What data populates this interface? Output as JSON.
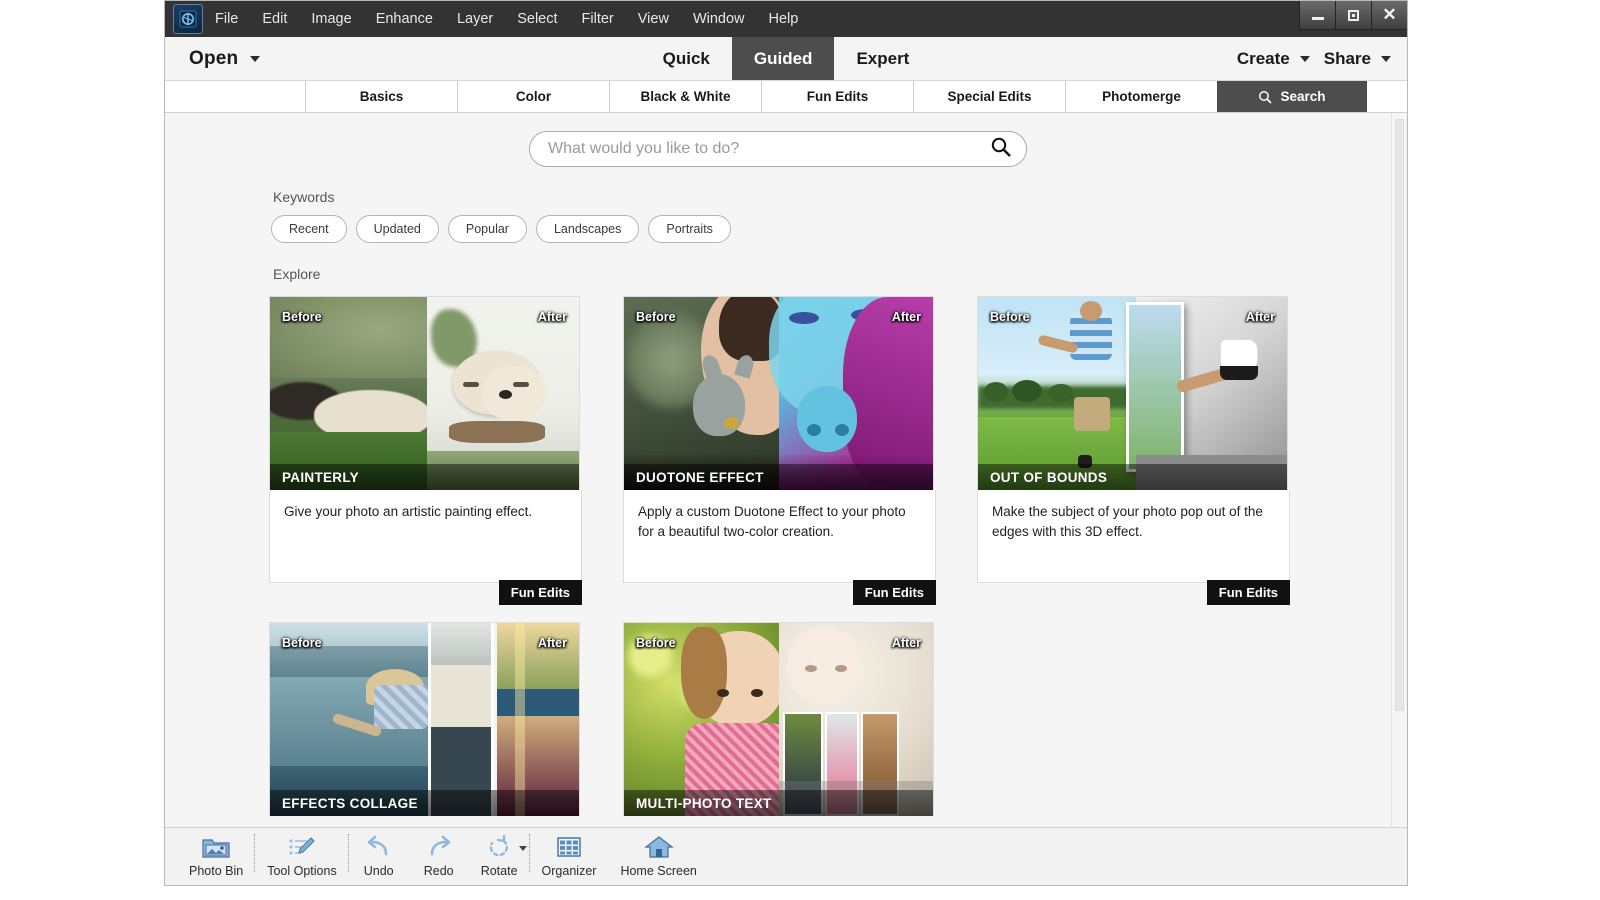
{
  "window": {
    "logo_icon": "photoshop-elements-logo-icon",
    "minimize_label": "minimize-icon",
    "maximize_label": "maximize-icon",
    "close_label": "✕"
  },
  "menubar": {
    "items": [
      {
        "label": "File"
      },
      {
        "label": "Edit"
      },
      {
        "label": "Image"
      },
      {
        "label": "Enhance"
      },
      {
        "label": "Layer"
      },
      {
        "label": "Select"
      },
      {
        "label": "Filter"
      },
      {
        "label": "View"
      },
      {
        "label": "Window"
      },
      {
        "label": "Help"
      }
    ]
  },
  "modebar": {
    "open_label": "Open",
    "modes": [
      {
        "label": "Quick",
        "active": false
      },
      {
        "label": "Guided",
        "active": true
      },
      {
        "label": "Expert",
        "active": false
      }
    ],
    "create_label": "Create",
    "share_label": "Share"
  },
  "tabs": [
    {
      "label": "Basics",
      "active": false
    },
    {
      "label": "Color",
      "active": false
    },
    {
      "label": "Black & White",
      "active": false
    },
    {
      "label": "Fun Edits",
      "active": false
    },
    {
      "label": "Special Edits",
      "active": false
    },
    {
      "label": "Photomerge",
      "active": false
    },
    {
      "label": "Search",
      "active": true,
      "icon": "search-icon"
    }
  ],
  "search": {
    "placeholder": "What would you like to do?",
    "value": "",
    "icon": "search-magnifier-icon"
  },
  "keywords": {
    "title": "Keywords",
    "chips": [
      {
        "label": "Recent"
      },
      {
        "label": "Updated"
      },
      {
        "label": "Popular"
      },
      {
        "label": "Landscapes"
      },
      {
        "label": "Portraits"
      }
    ]
  },
  "explore": {
    "title": "Explore",
    "badge_before": "Before",
    "badge_after": "After",
    "cards": [
      {
        "title": "PAINTERLY",
        "description": "Give your photo an artistic painting effect.",
        "category": "Fun Edits"
      },
      {
        "title": "DUOTONE EFFECT",
        "description": "Apply a custom Duotone Effect to your photo for a beautiful two-color creation.",
        "category": "Fun Edits"
      },
      {
        "title": "OUT OF BOUNDS",
        "description": "Make the subject of your photo pop out of the edges with this 3D effect.",
        "category": "Fun Edits"
      },
      {
        "title": "EFFECTS COLLAGE",
        "description": "",
        "category": ""
      },
      {
        "title": "MULTI-PHOTO TEXT",
        "description": "",
        "category": ""
      }
    ]
  },
  "taskbar": {
    "items": [
      {
        "label": "Photo Bin",
        "icon": "photo-bin-icon"
      },
      {
        "label": "Tool Options",
        "icon": "tool-options-icon"
      },
      {
        "label": "Undo",
        "icon": "undo-arrow-icon"
      },
      {
        "label": "Redo",
        "icon": "redo-arrow-icon"
      },
      {
        "label": "Rotate",
        "icon": "rotate-icon"
      },
      {
        "label": "Organizer",
        "icon": "organizer-grid-icon"
      },
      {
        "label": "Home Screen",
        "icon": "home-icon"
      }
    ]
  },
  "colors": {
    "menubar_bg": "#333333",
    "active_tab_bg": "#4d4d4d",
    "category_badge_bg": "#111111",
    "accent_blue": "#4a7fb5"
  }
}
